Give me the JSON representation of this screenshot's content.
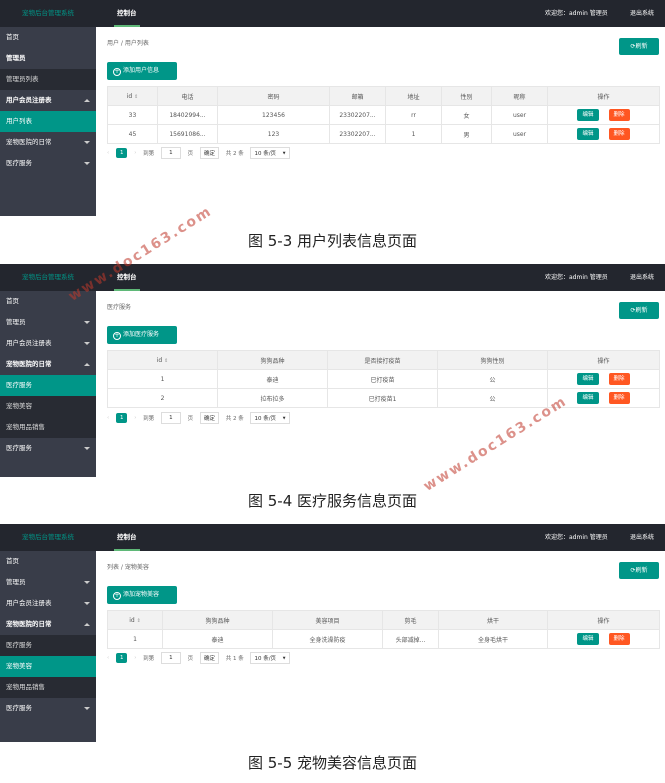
{
  "brand": "宠物后台管理系统",
  "top_nav": "控制台",
  "welcome": "欢迎您：admin 管理员",
  "logout": "退出系统",
  "refresh_label": "刷新",
  "captions": [
    "图 5-3 用户列表信息页面",
    "图 5-4 医疗服务信息页面",
    "图 5-5 宠物美容信息页面"
  ],
  "watermark": "www.doc163.com",
  "fig1": {
    "sidebar": [
      "首页",
      "管理员",
      "管理员列表",
      "用户会员注册表",
      "用户列表",
      "宠物医院的日常",
      "医疗服务"
    ],
    "breadcrumb": "用户  /  用户列表",
    "add_label": "添加用户信息",
    "columns": [
      "id",
      "电话",
      "密码",
      "邮箱",
      "地址",
      "性别",
      "昵称",
      "操作"
    ],
    "rows": [
      [
        "33",
        "18402994...",
        "123456",
        "23302207...",
        "rr",
        "女",
        "user"
      ],
      [
        "45",
        "15691086...",
        "123",
        "23302207...",
        "1",
        "男",
        "user"
      ]
    ],
    "edit": "编辑",
    "del": "删除",
    "pager": {
      "page": "1",
      "goto": "到第",
      "goto_page": "1",
      "page_unit": "页",
      "confirm": "确定",
      "total": "共 2 条",
      "size": "10 条/页"
    }
  },
  "fig2": {
    "sidebar": [
      "首页",
      "管理员",
      "用户会员注册表",
      "宠物医院的日常",
      "医疗服务",
      "宠物美容",
      "宠物用品销售",
      "医疗服务"
    ],
    "breadcrumb": "医疗服务",
    "add_label": "添加医疗服务",
    "columns": [
      "id",
      "狗狗品种",
      "是否接打疫苗",
      "狗狗性别",
      "操作"
    ],
    "rows": [
      [
        "1",
        "泰迪",
        "已打疫苗",
        "公"
      ],
      [
        "2",
        "拉布拉多",
        "已打疫苗1",
        "公"
      ]
    ],
    "edit": "编辑",
    "del": "删除",
    "pager": {
      "page": "1",
      "goto": "到第",
      "goto_page": "1",
      "page_unit": "页",
      "confirm": "确定",
      "total": "共 2 条",
      "size": "10 条/页"
    }
  },
  "fig3": {
    "sidebar": [
      "首页",
      "管理员",
      "用户会员注册表",
      "宠物医院的日常",
      "医疗服务",
      "宠物美容",
      "宠物用品销售",
      "医疗服务"
    ],
    "breadcrumb": "列表  /  宠物美容",
    "add_label": "添加宠物美容",
    "columns": [
      "id",
      "狗狗品种",
      "美容项目",
      "剪毛",
      "烘干",
      "操作"
    ],
    "rows": [
      [
        "1",
        "泰迪",
        "全身洗澡防疫",
        "头部减掉...",
        "全身毛烘干"
      ]
    ],
    "edit": "编辑",
    "del": "删除",
    "pager": {
      "page": "1",
      "goto": "到第",
      "goto_page": "1",
      "page_unit": "页",
      "confirm": "确定",
      "total": "共 1 条",
      "size": "10 条/页"
    }
  }
}
